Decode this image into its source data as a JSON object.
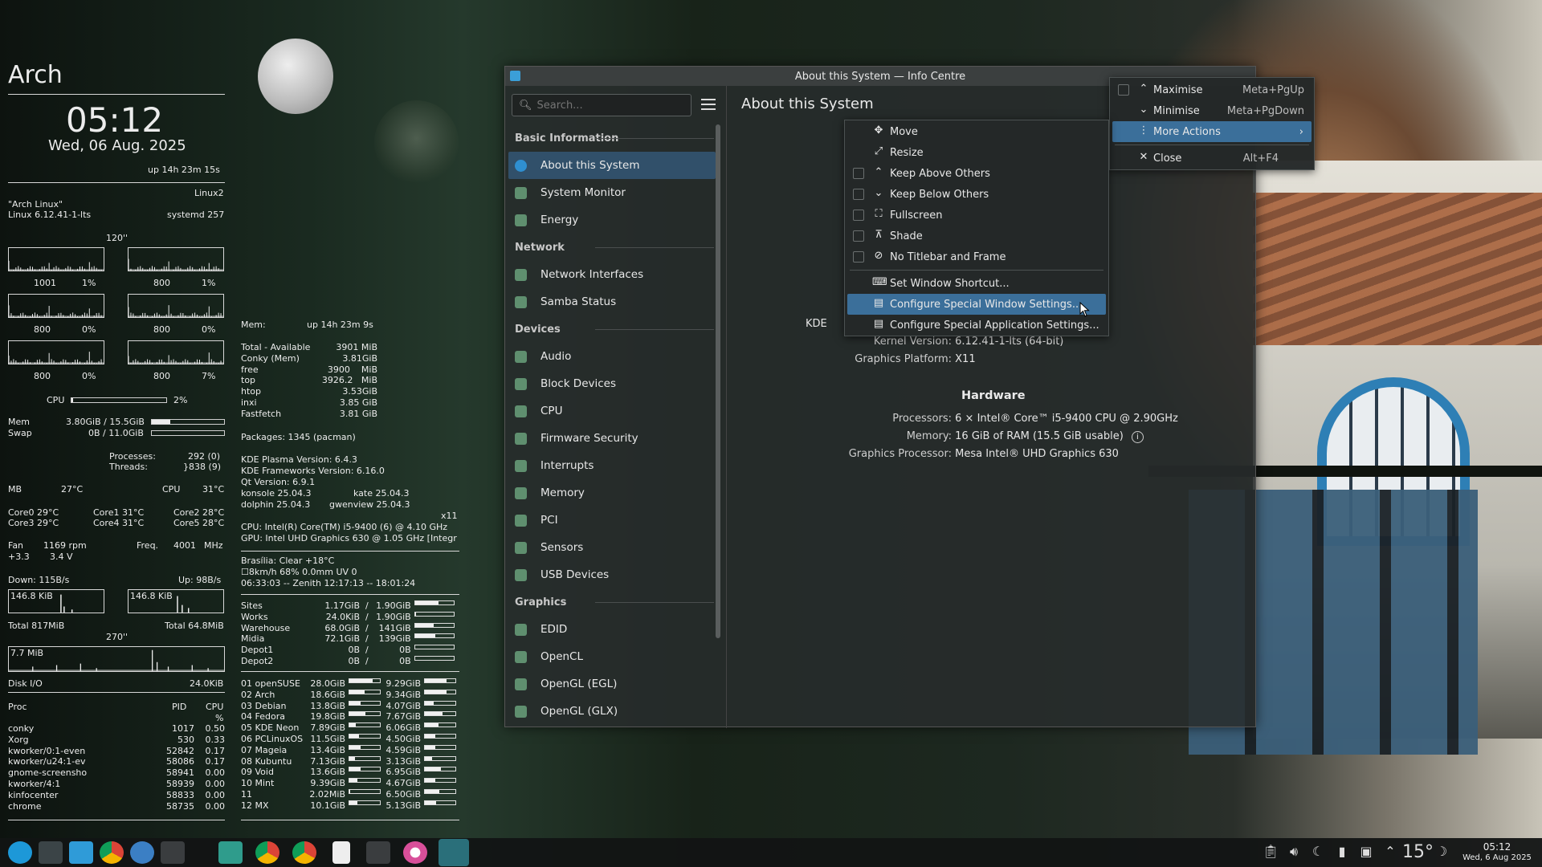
{
  "conky_left": {
    "host": "Arch",
    "time": "05:12",
    "date": "Wed, 06 Aug. 2025",
    "uptime": "up  14h 23m 15s",
    "kind": "Linux2",
    "distro": "\"Arch Linux\"",
    "kernel": "Linux 6.12.41-1-lts",
    "systemd": "systemd 257",
    "interval": "120''",
    "cpu_graphs": [
      [
        "1001",
        "1%"
      ],
      [
        "800",
        "1%"
      ],
      [
        "800",
        "0%"
      ],
      [
        "800",
        "0%"
      ],
      [
        "800",
        "0%"
      ],
      [
        "800",
        "7%"
      ]
    ],
    "cpu_label": "CPU",
    "cpu_pct": "2%",
    "cpu_val": 0.02,
    "mem_label": "Mem",
    "mem_val": "3.80GiB / 15.5GiB",
    "mem_frac": 0.25,
    "swap_label": "Swap",
    "swap_val": "0B / 11.0GiB",
    "swap_frac": 0,
    "processes_label": "Processes:",
    "processes": "292 (0)",
    "threads_label": "Threads:",
    "threads": "}838 (9)",
    "mb_label": "MB",
    "mb_temp": "27°C",
    "cpu_t_label": "CPU",
    "cpu_temp": "31°C",
    "cores": [
      [
        "Core0 29°C",
        "Core1 31°C",
        "Core2 28°C"
      ],
      [
        "Core3 29°C",
        "Core4 31°C",
        "Core5 28°C"
      ]
    ],
    "fan": "Fan",
    "fan_rpm": "1169 rpm",
    "freq_label": "Freq.",
    "freq": "4001",
    "freq_unit": "MHz",
    "v1": "+3.3",
    "v2": "3.4 V",
    "down": "Down: 115B/s",
    "up": "Up: 98B/s",
    "down_peak": "146.8 KiB",
    "up_peak": "146.8 KiB",
    "total_down": "Total 817MiB",
    "total_up": "Total 64.8MiB",
    "interval2": "270''",
    "disk_peak": "7.7 MiB",
    "disk_label": "Disk I/O",
    "disk_val": "24.0KiB",
    "proc_headers": [
      "Proc",
      "PID",
      "CPU",
      "%"
    ],
    "procs": [
      [
        "conky",
        "1017",
        "0.50"
      ],
      [
        "Xorg",
        "530",
        "0.33"
      ],
      [
        "kworker/0:1-even",
        "52842",
        "0.17"
      ],
      [
        "kworker/u24:1-ev",
        "58086",
        "0.17"
      ],
      [
        "gnome-screensho",
        "58941",
        "0.00"
      ],
      [
        "kworker/4:1",
        "58939",
        "0.00"
      ],
      [
        "kinfocenter",
        "58833",
        "0.00"
      ],
      [
        "chrome",
        "58735",
        "0.00"
      ]
    ]
  },
  "conky_mid": {
    "mem_label": "Mem:",
    "uptime": "up  14h 23m 9s",
    "mem_rows": [
      [
        "Total - Available",
        "3901 MiB"
      ],
      [
        "Conky (Mem)",
        "3.81GiB"
      ],
      [
        "free",
        "3900    MiB"
      ],
      [
        "top",
        "3926.2   MiB"
      ],
      [
        "htop",
        "3.53GiB"
      ],
      [
        "inxi",
        "3.85 GiB"
      ],
      [
        "Fastfetch",
        "3.81 GiB"
      ]
    ],
    "packages": "Packages: 1345 (pacman)",
    "versions": [
      "KDE Plasma Version: 6.4.3",
      "KDE Frameworks Version: 6.16.0",
      "Qt Version: 6.9.1"
    ],
    "konsole": "konsole 25.04.3",
    "kate": "kate 25.04.3",
    "dolphin": "dolphin 25.04.3",
    "gwenview": "gwenview 25.04.3",
    "x11": "x11",
    "cpu": "CPU: Intel(R) Core(TM) i5-9400 (6) @ 4.10 GHz",
    "gpu": "GPU: Intel UHD Graphics 630 @ 1.05 GHz [Integr",
    "weather1": "Brasília:   Clear   +18°C",
    "weather2": "☐8km/h    68%   0.0mm   UV 0",
    "weather3": "06:33:03 -- Zenith 12:17:13 -- 18:01:24",
    "disks": [
      [
        "Sites",
        "1.17GiB",
        "1.90GiB",
        0.62
      ],
      [
        "Works",
        "24.0KiB",
        "1.90GiB",
        0.01
      ],
      [
        "Warehouse",
        "68.0GiB",
        "141GiB",
        0.48
      ],
      [
        "Midia",
        "72.1GiB",
        "139GiB",
        0.52
      ],
      [
        "Depot1",
        "0B",
        "0B",
        0
      ],
      [
        "Depot2",
        "0B",
        "0B",
        0
      ]
    ],
    "distros": [
      [
        "01 openSUSE",
        "28.0GiB",
        0.75,
        "9.29GiB",
        0.7
      ],
      [
        "02 Arch",
        "18.6GiB",
        0.5,
        "9.34GiB",
        0.7
      ],
      [
        "03 Debian",
        "13.8GiB",
        0.37,
        "4.07GiB",
        0.3
      ],
      [
        "04 Fedora",
        "19.8GiB",
        0.53,
        "7.67GiB",
        0.57
      ],
      [
        "05 KDE Neon",
        "7.89GiB",
        0.21,
        "6.06GiB",
        0.45
      ],
      [
        "06 PCLinuxOS",
        "11.5GiB",
        0.31,
        "4.50GiB",
        0.33
      ],
      [
        "07 Mageia",
        "13.4GiB",
        0.36,
        "4.59GiB",
        0.34
      ],
      [
        "08 Kubuntu",
        "7.13GiB",
        0.19,
        "3.13GiB",
        0.23
      ],
      [
        "09 Void",
        "13.6GiB",
        0.36,
        "6.95GiB",
        0.52
      ],
      [
        "10 Mint",
        "9.39GiB",
        0.25,
        "4.67GiB",
        0.35
      ],
      [
        "11",
        "2.02MiB",
        0.01,
        "6.50GiB",
        0.48
      ],
      [
        "12 MX",
        "10.1GiB",
        0.27,
        "5.13GiB",
        0.38
      ]
    ]
  },
  "window": {
    "title": "About this System — Info Centre",
    "search_placeholder": "Search...",
    "page_title": "About this System",
    "sidebar": [
      {
        "section": "Basic Information",
        "items": [
          "About this System",
          "System Monitor",
          "Energy"
        ]
      },
      {
        "section": "Network",
        "items": [
          "Network Interfaces",
          "Samba Status"
        ]
      },
      {
        "section": "Devices",
        "items": [
          "Audio",
          "Block Devices",
          "CPU",
          "Firmware Security",
          "Interrupts",
          "Memory",
          "PCI",
          "Sensors",
          "USB Devices"
        ]
      },
      {
        "section": "Graphics",
        "items": [
          "EDID",
          "OpenCL",
          "OpenGL (EGL)",
          "OpenGL (GLX)"
        ]
      }
    ],
    "kde_partial": "KDE",
    "kernel_label": "Kernel Version:",
    "kernel": "6.12.41-1-lts (64-bit)",
    "platform_label": "Graphics Platform:",
    "platform": "X11",
    "hardware_title": "Hardware",
    "proc_label": "Processors:",
    "proc": "6 × Intel® Core™ i5-9400 CPU @ 2.90GHz",
    "mem_label": "Memory:",
    "mem": "16 GiB of RAM (15.5 GiB usable)",
    "gpu_label": "Graphics Processor:",
    "gpu": "Mesa Intel® UHD Graphics 630"
  },
  "window_menu": {
    "items": [
      {
        "label": "Maximise",
        "shortcut": "Meta+PgUp"
      },
      {
        "label": "Minimise",
        "shortcut": "Meta+PgDown"
      },
      {
        "label": "More Actions"
      },
      {
        "label": "Close",
        "shortcut": "Alt+F4"
      }
    ]
  },
  "submenu": {
    "items": [
      "Move",
      "Resize",
      "Keep Above Others",
      "Keep Below Others",
      "Fullscreen",
      "Shade",
      "No Titlebar and Frame",
      "Set Window Shortcut...",
      "Configure Special Window Settings...",
      "Configure Special Application Settings..."
    ]
  },
  "taskbar": {
    "temp": "15°",
    "clock_time": "05:12",
    "clock_date": "Wed, 6 Aug 2025"
  }
}
